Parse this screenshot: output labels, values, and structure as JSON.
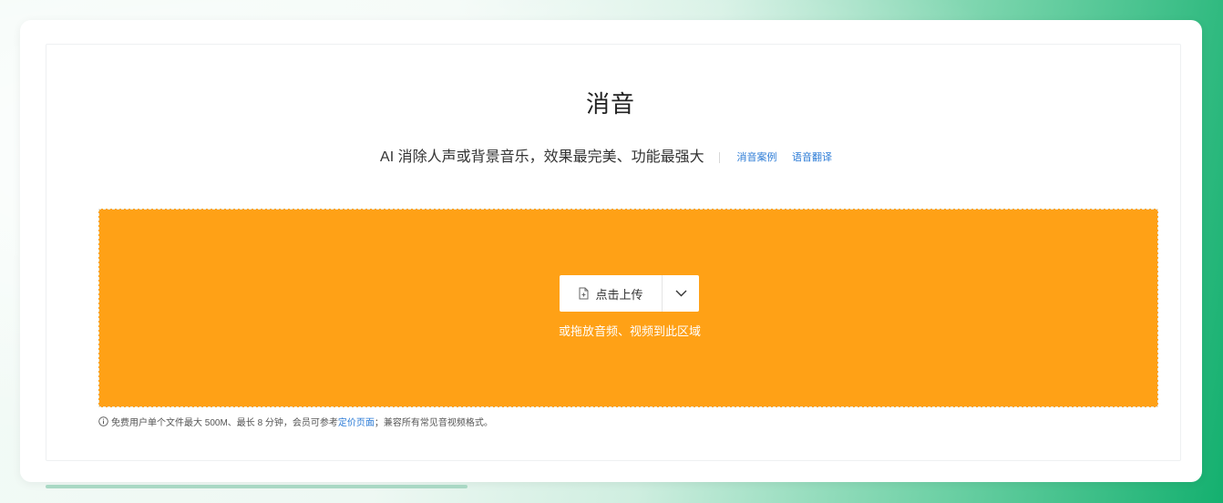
{
  "header": {
    "title": "消音",
    "subtitle": "AI 消除人声或背景音乐，效果最完美、功能最强大",
    "links": [
      "消音案例",
      "语音翻译"
    ]
  },
  "upload": {
    "button_label": "点击上传",
    "drop_hint": "或拖放音频、视频到此区域"
  },
  "note": {
    "text_before": "免费用户单个文件最大 500M、最长 8 分钟，会员可参考",
    "link": "定价页面",
    "text_after": "；兼容所有常见音视频格式。"
  },
  "icons": {
    "upload": "file-plus-icon",
    "dropdown": "chevron-down-icon",
    "info": "info-circle-icon"
  },
  "colors": {
    "dropzone": "#ffa116",
    "link": "#2b7bd6",
    "accent_green": "#14b06f"
  }
}
